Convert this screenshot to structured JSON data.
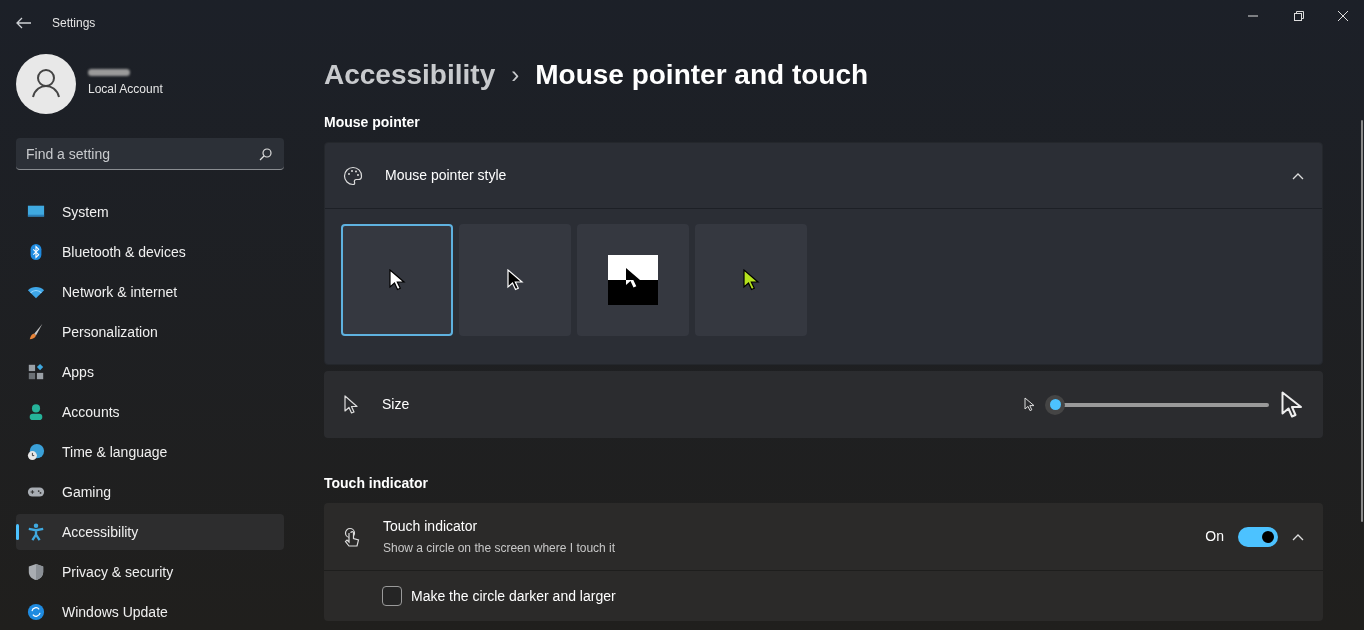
{
  "window": {
    "title": "Settings"
  },
  "account": {
    "type": "Local Account"
  },
  "search": {
    "placeholder": "Find a setting"
  },
  "nav": [
    {
      "label": "System",
      "selected": false
    },
    {
      "label": "Bluetooth & devices",
      "selected": false
    },
    {
      "label": "Network & internet",
      "selected": false
    },
    {
      "label": "Personalization",
      "selected": false
    },
    {
      "label": "Apps",
      "selected": false
    },
    {
      "label": "Accounts",
      "selected": false
    },
    {
      "label": "Time & language",
      "selected": false
    },
    {
      "label": "Gaming",
      "selected": false
    },
    {
      "label": "Accessibility",
      "selected": true
    },
    {
      "label": "Privacy & security",
      "selected": false
    },
    {
      "label": "Windows Update",
      "selected": false
    }
  ],
  "breadcrumb": {
    "parent": "Accessibility",
    "separator": "›",
    "current": "Mouse pointer and touch"
  },
  "mouse_pointer": {
    "heading": "Mouse pointer",
    "style": {
      "label": "Mouse pointer style",
      "expanded": true,
      "options": [
        {
          "kind": "white",
          "selected": true
        },
        {
          "kind": "black",
          "selected": false
        },
        {
          "kind": "inverted",
          "selected": false
        },
        {
          "kind": "custom",
          "color": "#b5e21d",
          "selected": false
        }
      ]
    },
    "size": {
      "label": "Size"
    }
  },
  "touch": {
    "heading": "Touch indicator",
    "label": "Touch indicator",
    "description": "Show a circle on the screen where I touch it",
    "state": "On",
    "on": true,
    "expanded": true,
    "option": {
      "label": "Make the circle darker and larger",
      "checked": false
    }
  }
}
